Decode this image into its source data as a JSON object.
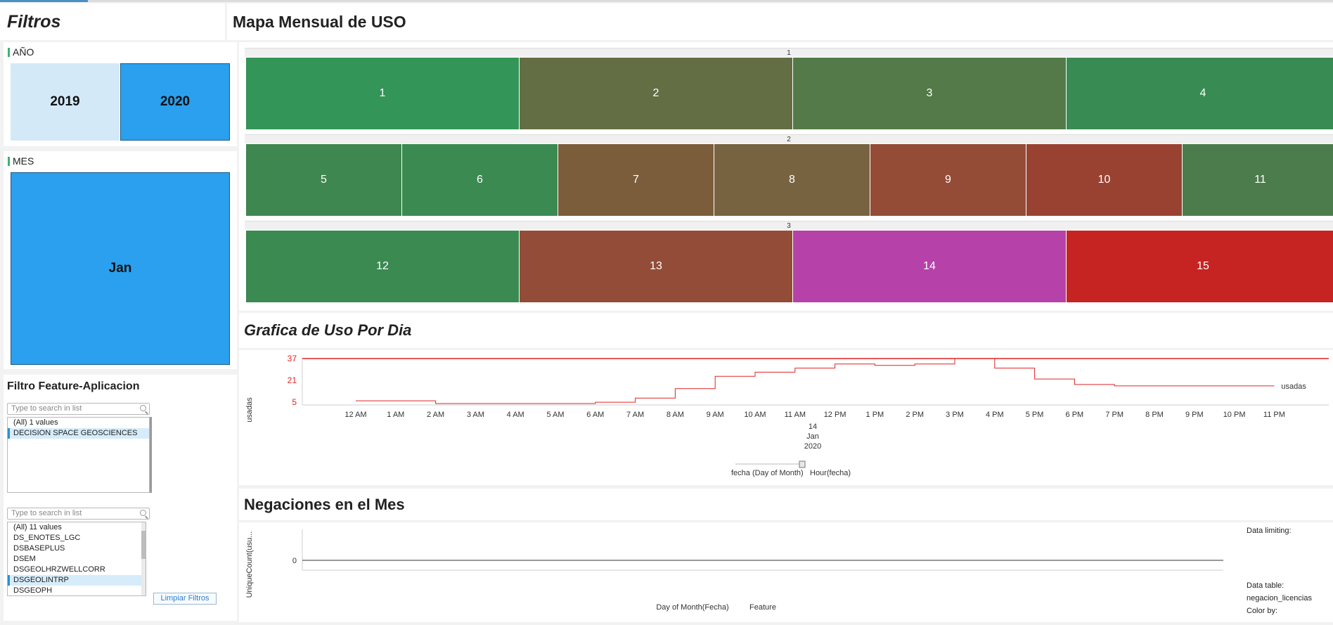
{
  "filters": {
    "title": "Filtros",
    "anio": {
      "label": "AÑO",
      "options": [
        "2019",
        "2020"
      ],
      "selected": "2020"
    },
    "mes": {
      "label": "MES",
      "options": [
        "Jan"
      ],
      "selected": "Jan"
    },
    "feature": {
      "title": "Filtro Feature-Aplicacion",
      "search_placeholder": "Type to search in list",
      "list1": [
        "(All) 1 values",
        "DECISION SPACE GEOSCIENCES"
      ],
      "list1_selected": "DECISION SPACE GEOSCIENCES",
      "list2": [
        "(All) 11 values",
        "DS_ENOTES_LGC",
        "DSBASEPLUS",
        "DSEM",
        "DSGEOLHRZWELLCORR",
        "DSGEOLINTRP",
        "DSGEOPH"
      ],
      "list2_selected": "DSGEOLINTRP",
      "clear_button": "Limpiar Filtros"
    }
  },
  "heatmap": {
    "title": "Mapa Mensual de USO",
    "weeks": [
      {
        "label": "1",
        "days": [
          {
            "day": "1",
            "color": "#339557"
          },
          {
            "day": "2",
            "color": "#646e44"
          },
          {
            "day": "3",
            "color": "#537a48"
          },
          {
            "day": "4",
            "color": "#388c53"
          }
        ]
      },
      {
        "label": "2",
        "days": [
          {
            "day": "5",
            "color": "#3f8750"
          },
          {
            "day": "6",
            "color": "#3a8a51"
          },
          {
            "day": "7",
            "color": "#7b5d3c"
          },
          {
            "day": "8",
            "color": "#77633f"
          },
          {
            "day": "9",
            "color": "#944c37"
          },
          {
            "day": "10",
            "color": "#9a4232"
          },
          {
            "day": "11",
            "color": "#4c7c4b"
          }
        ]
      },
      {
        "label": "3",
        "days": [
          {
            "day": "12",
            "color": "#3a8a51"
          },
          {
            "day": "13",
            "color": "#934c37"
          },
          {
            "day": "14",
            "color": "#b641a9"
          },
          {
            "day": "15",
            "color": "#c62423"
          }
        ]
      }
    ]
  },
  "usage_chart": {
    "title": "Grafica de Uso Por Dia",
    "ylabel": "usadas",
    "series_label": "usadas",
    "x_axis_labels": [
      "14",
      "Jan",
      "2020"
    ],
    "slider_labels": [
      "fecha (Day of Month)",
      "Hour(fecha)"
    ],
    "line_color": "#e02424"
  },
  "negaciones": {
    "title": "Negaciones en el Mes",
    "ylabel": "UniqueCount(usu...",
    "xlabel": "Day of Month(Fecha)",
    "xlabel2": "Feature",
    "info": [
      "Data limiting:",
      "Data table:",
      "negacion_licencias",
      "Color by:"
    ]
  },
  "chart_data": [
    {
      "type": "line",
      "title": "Grafica de Uso Por Dia",
      "ylabel": "usadas",
      "categories": [
        "12 AM",
        "1 AM",
        "2 AM",
        "3 AM",
        "4 AM",
        "5 AM",
        "6 AM",
        "7 AM",
        "8 AM",
        "9 AM",
        "10 AM",
        "11 AM",
        "12 PM",
        "1 PM",
        "2 PM",
        "3 PM",
        "4 PM",
        "5 PM",
        "6 PM",
        "7 PM",
        "8 PM",
        "9 PM",
        "10 PM",
        "11 PM"
      ],
      "yticks": [
        5,
        21,
        37
      ],
      "ylim": [
        3,
        37
      ],
      "series": [
        {
          "name": "usadas",
          "values": [
            6,
            6,
            4,
            4,
            4,
            4,
            5,
            8,
            15,
            24,
            27,
            30,
            33,
            32,
            33,
            37,
            30,
            22,
            18,
            17,
            17,
            17,
            17,
            17
          ]
        }
      ],
      "reference_line": 37
    },
    {
      "type": "line",
      "title": "Negaciones en el Mes",
      "ylabel": "UniqueCount(usu...",
      "xlabel": "Day of Month(Fecha)",
      "yticks": [
        0
      ],
      "series": [
        {
          "values": [
            0,
            0
          ]
        }
      ]
    }
  ]
}
